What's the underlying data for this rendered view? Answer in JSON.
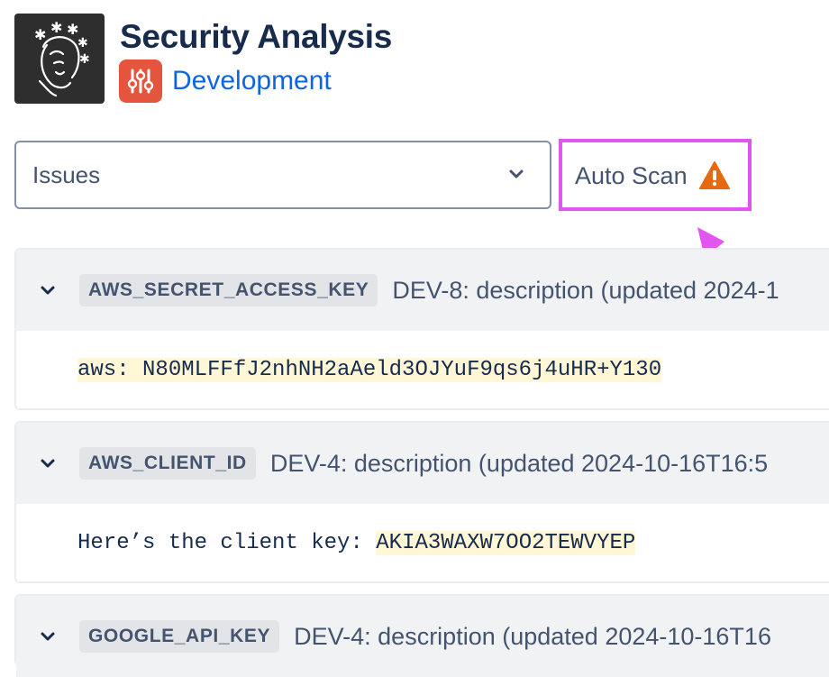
{
  "app": {
    "title": "Security Analysis",
    "logo_icon": "face-stars-logo",
    "project_icon": "sliders-icon",
    "project_name": "Development"
  },
  "filter": {
    "selected": "Issues",
    "chevron_icon": "chevron-down-icon"
  },
  "auto_scan": {
    "label": "Auto Scan",
    "icon": "warning-icon",
    "warning_color": "#e56910",
    "highlight_color": "#e255f0"
  },
  "findings": [
    {
      "key": "AWS_SECRET_ACCESS_KEY",
      "summary": "DEV-8: description (updated 2024-1",
      "line_prefix": "",
      "secret": "aws: N80MLFFfJ2nhNH2aAeld3OJYuF9qs6j4uHR+Y130"
    },
    {
      "key": "AWS_CLIENT_ID",
      "summary": "DEV-4: description (updated 2024-10-16T16:5",
      "line_prefix": "Here’s the client key: ",
      "secret": "AKIA3WAXW7OO2TEWVYEP"
    },
    {
      "key": "GOOGLE_API_KEY",
      "summary": "DEV-4: description (updated 2024-10-16T16"
    }
  ]
}
